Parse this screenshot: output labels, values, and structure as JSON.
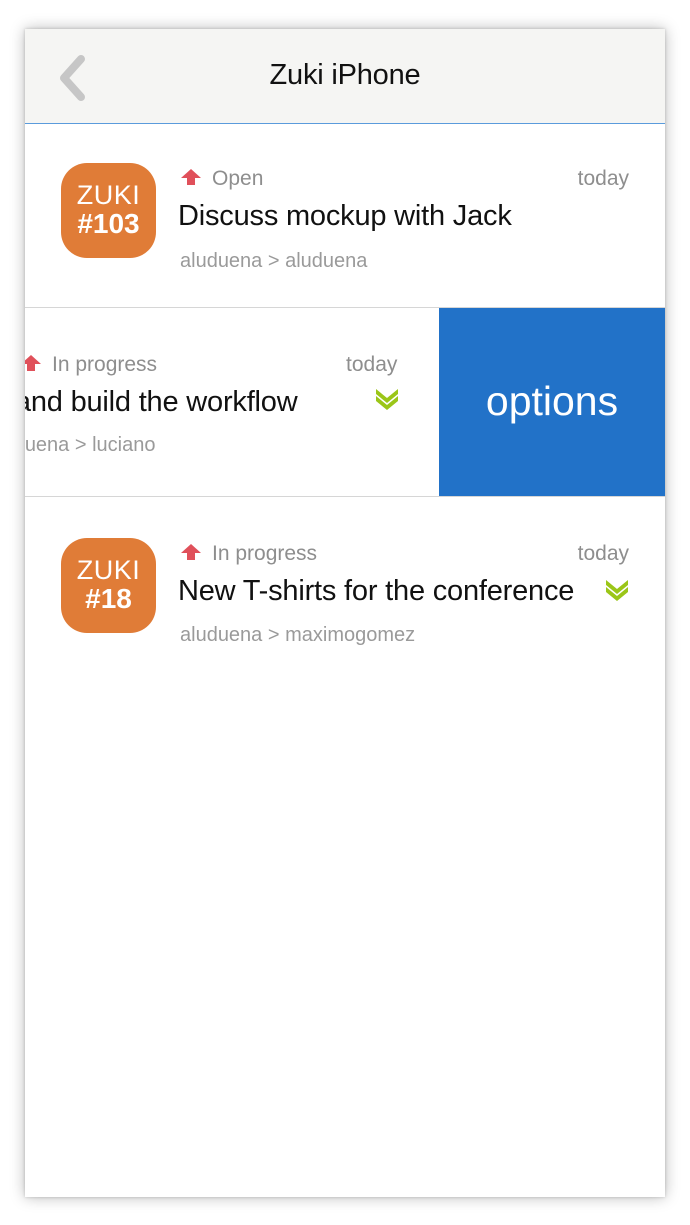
{
  "header": {
    "title": "Zuki iPhone",
    "back_icon": "chevron-left-icon"
  },
  "colors": {
    "badge": "#e07c37",
    "options_bg": "#2272c8",
    "priority_up": "#e0505a",
    "priority_down": "#9bc618",
    "nav_border": "#5a9bdc"
  },
  "tasks": [
    {
      "badge_top": "ZUKI",
      "badge_number": "#103",
      "priority_icon": "arrow-up-icon",
      "status": "Open",
      "time": "today",
      "title": "Discuss mockup with Jack",
      "path": "aluduena > aluduena"
    },
    {
      "status": "In progress",
      "time": "today",
      "title": "Design and build the workflow",
      "path": "aluduena > luciano",
      "indicator_icon": "double-chevron-down-icon",
      "swipe_action": "options"
    },
    {
      "badge_top": "ZUKI",
      "badge_number": "#18",
      "priority_icon": "arrow-up-icon",
      "status": "In progress",
      "time": "today",
      "title": "New T-shirts for the conference",
      "path": "aluduena > maximogomez",
      "indicator_icon": "double-chevron-down-icon"
    }
  ]
}
